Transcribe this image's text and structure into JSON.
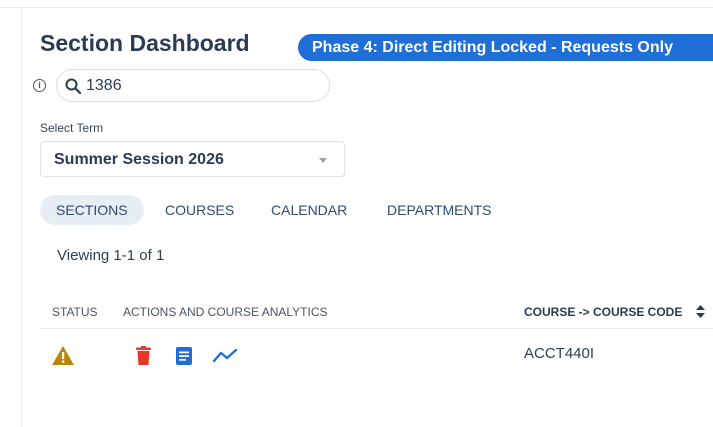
{
  "page": {
    "title": "Section Dashboard",
    "phase_badge": "Phase 4: Direct Editing Locked - Requests Only"
  },
  "search": {
    "value": "1386",
    "placeholder": ""
  },
  "term": {
    "label": "Select Term",
    "selected": "Summer Session 2026"
  },
  "tabs": [
    {
      "label": "SECTIONS",
      "active": true
    },
    {
      "label": "COURSES",
      "active": false
    },
    {
      "label": "CALENDAR",
      "active": false
    },
    {
      "label": "DEPARTMENTS",
      "active": false
    }
  ],
  "viewing": "Viewing 1-1 of 1",
  "table": {
    "columns": [
      "STATUS",
      "ACTIONS AND COURSE ANALYTICS",
      "COURSE -> COURSE CODE"
    ],
    "rows": [
      {
        "status_icon": "warning-icon",
        "actions": [
          "delete-icon",
          "document-icon",
          "analytics-icon"
        ],
        "course_code": "ACCT440I"
      }
    ]
  },
  "colors": {
    "accent": "#1f6fd6",
    "warning": "#b8860b",
    "delete": "#e5392b",
    "document": "#1f6fd6",
    "analytics": "#1f6fd6"
  }
}
